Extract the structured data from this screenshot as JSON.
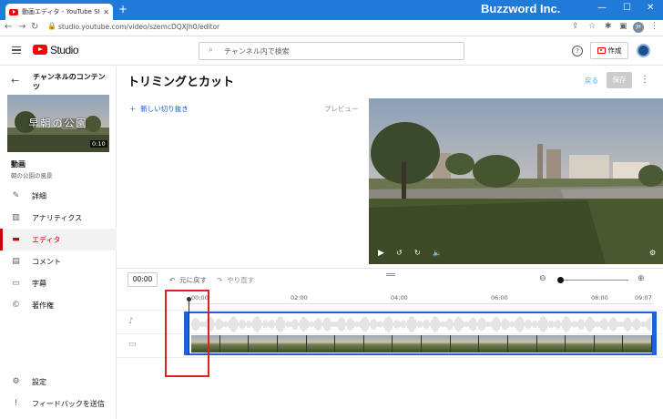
{
  "browser": {
    "tab_title": "動画エディタ - YouTube Studio",
    "url": "studio.youtube.com/video/szemcDQXJh0/editor",
    "watermark": "Buzzword Inc."
  },
  "header": {
    "logo_text": "Studio",
    "search_placeholder": "チャンネル内で検索",
    "create_label": "作成"
  },
  "sidebar": {
    "title": "チャンネルのコンテンツ",
    "thumbnail_caption": "早朝の公園",
    "thumbnail_duration": "0:10",
    "video_heading": "動画",
    "video_name": "朝の公園の風景",
    "items": [
      {
        "label": "詳細",
        "icon": "pencil-icon",
        "active": false
      },
      {
        "label": "アナリティクス",
        "icon": "analytics-icon",
        "active": false
      },
      {
        "label": "エディタ",
        "icon": "clapper-icon",
        "active": true
      },
      {
        "label": "コメント",
        "icon": "comment-icon",
        "active": false
      },
      {
        "label": "字幕",
        "icon": "subtitles-icon",
        "active": false
      },
      {
        "label": "著作権",
        "icon": "copyright-icon",
        "active": false
      }
    ],
    "settings_label": "設定",
    "feedback_label": "フィードバックを送信"
  },
  "main": {
    "title": "トリミングとカット",
    "undo_top": "戻る",
    "save_label": "保存",
    "new_cut": "新しい切り抜き",
    "preview_label": "プレビュー"
  },
  "timeline": {
    "timecode": "00:00",
    "undo_label": "元に戻す",
    "redo_label": "やり直す",
    "ticks": [
      "00:00",
      "02:00",
      "04:00",
      "06:00",
      "08:00",
      "09:07"
    ]
  },
  "colors": {
    "accent_blue": "#2160d9",
    "active_red": "#cc0000",
    "highlight_red": "#e02020",
    "chrome_blue": "#1f7ad8"
  }
}
